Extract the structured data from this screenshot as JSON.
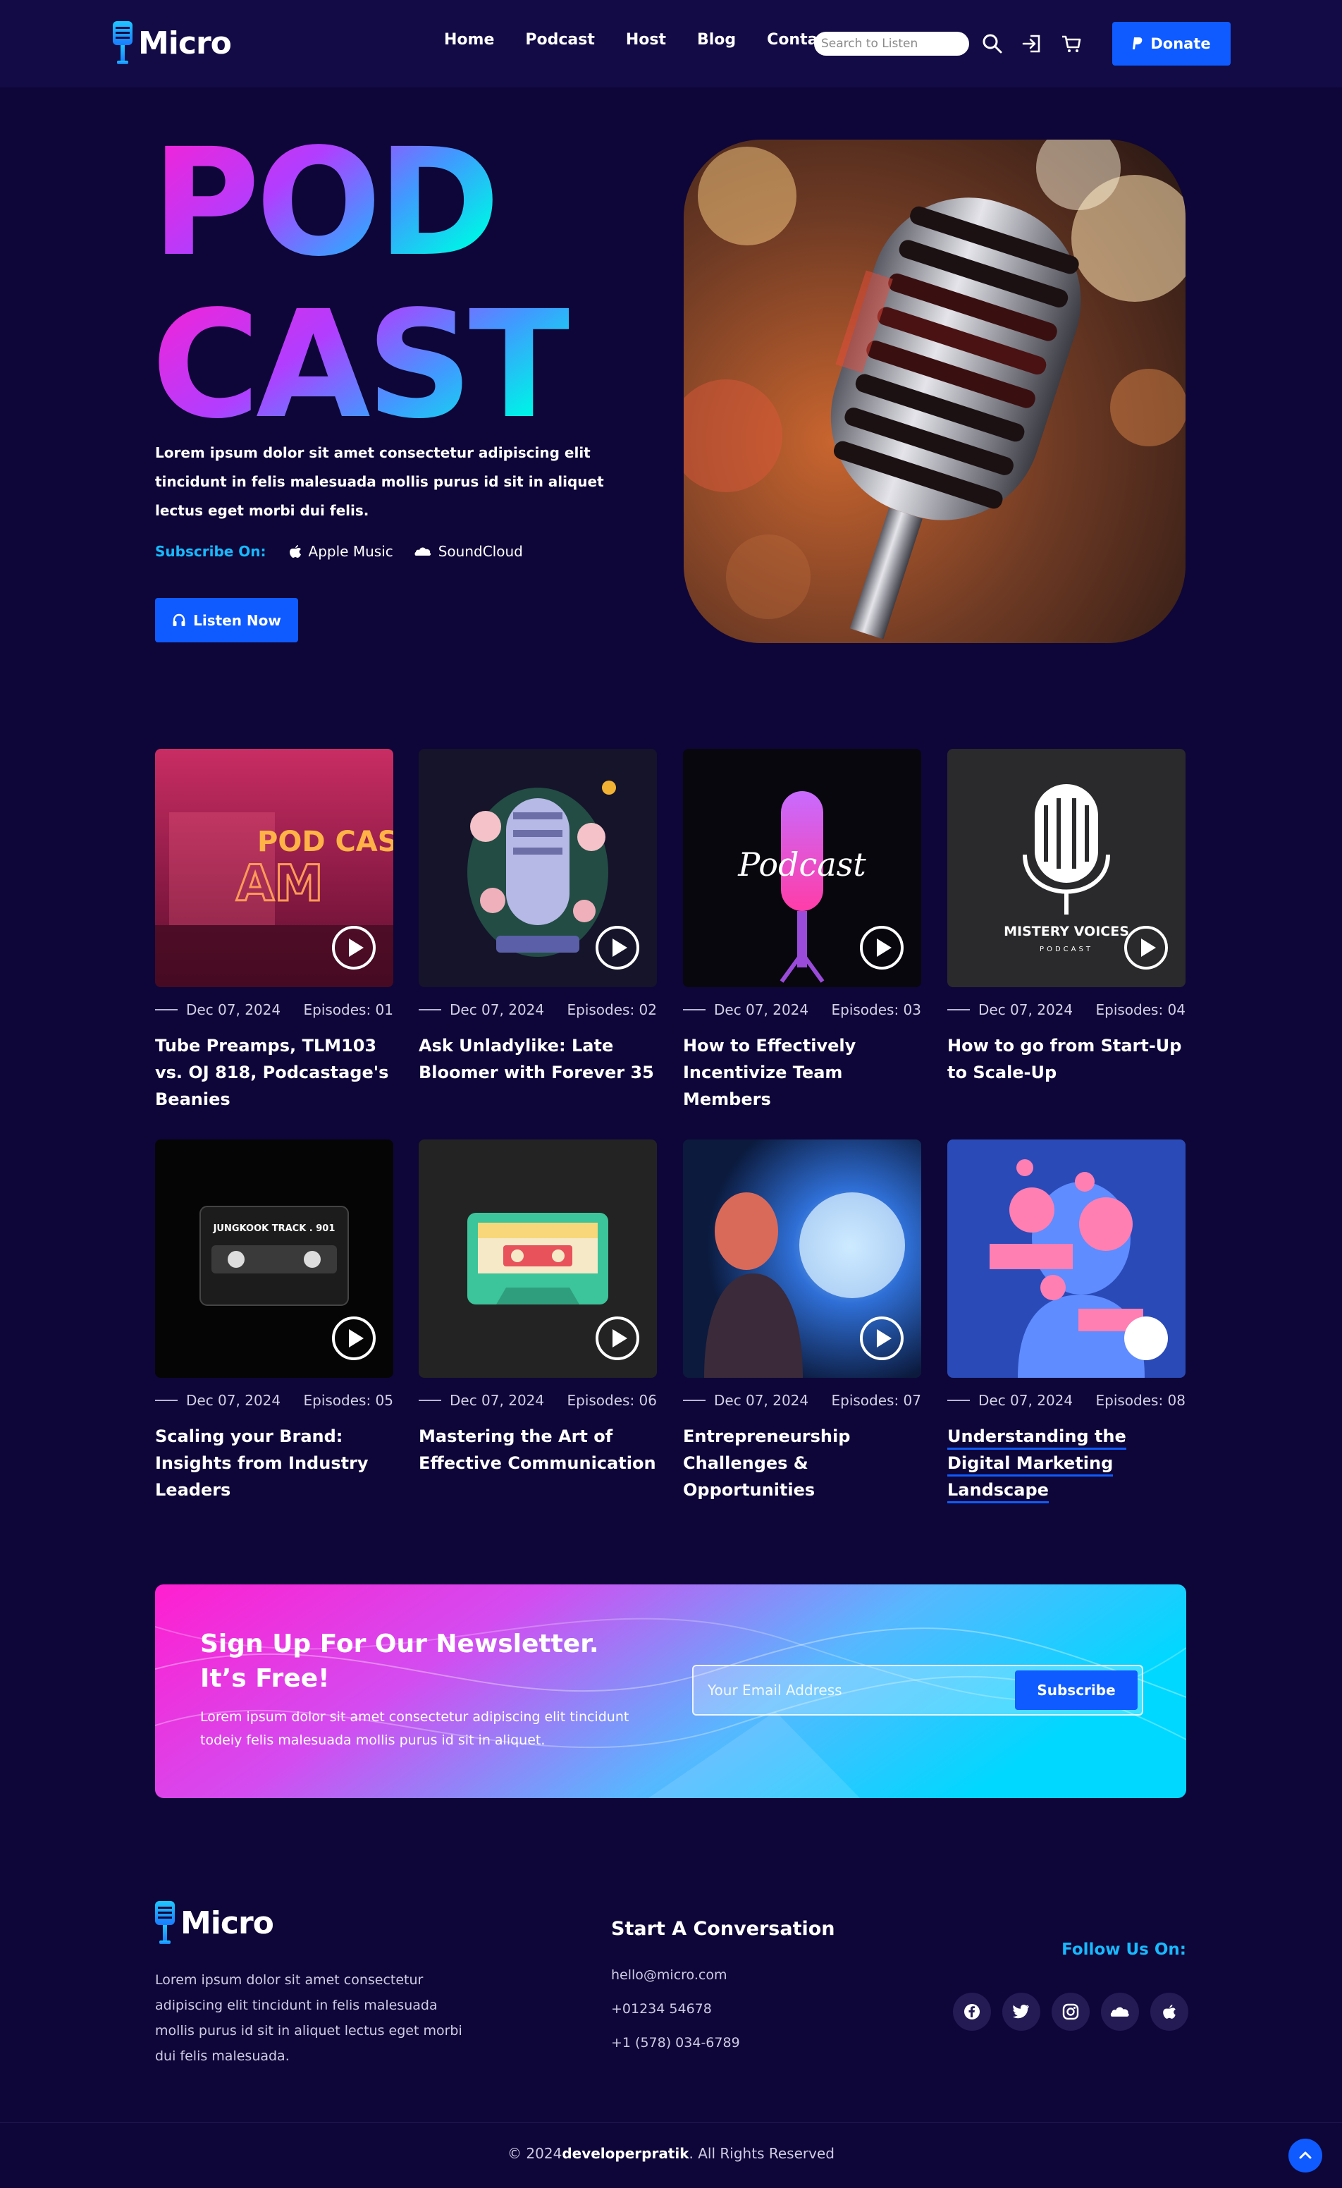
{
  "brand": {
    "name": "Micro"
  },
  "nav": {
    "items": [
      "Home",
      "Podcast",
      "Host",
      "Blog",
      "Contact"
    ],
    "search_placeholder": "Search to Listen",
    "donate_label": "Donate"
  },
  "hero": {
    "title_line1": "POD",
    "title_line2": "CAST",
    "description": "Lorem ipsum dolor sit amet consectetur adipiscing elit tincidunt in felis malesuada mollis purus id sit in aliquet lectus eget morbi dui felis.",
    "subscribe_label": "Subscribe On:",
    "platforms": [
      "Apple Music",
      "SoundCloud"
    ],
    "listen_label": "Listen Now"
  },
  "episodes": [
    {
      "date": "Dec 07, 2024",
      "episode": "Episodes: 01",
      "title": "Tube Preamps, TLM103 vs. OJ 818, Podcastage's Beanies",
      "art_text": "POD CAST",
      "art_sub": "AM"
    },
    {
      "date": "Dec 07, 2024",
      "episode": "Episodes: 02",
      "title": "Ask Unladylike: Late Bloomer with Forever 35"
    },
    {
      "date": "Dec 07, 2024",
      "episode": "Episodes: 03",
      "title": "How to Effectively Incentivize Team Members",
      "art_text": "Podcast"
    },
    {
      "date": "Dec 07, 2024",
      "episode": "Episodes: 04",
      "title": "How to go from Start-Up to Scale-Up",
      "art_text": "MISTERY VOICES",
      "art_sub": "PODCAST"
    },
    {
      "date": "Dec 07, 2024",
      "episode": "Episodes: 05",
      "title": "Scaling your Brand: Insights from Industry Leaders",
      "art_text": "JUNGKOOK TRACK . 901"
    },
    {
      "date": "Dec 07, 2024",
      "episode": "Episodes: 06",
      "title": "Mastering the Art of Effective Communication"
    },
    {
      "date": "Dec 07, 2024",
      "episode": "Episodes: 07",
      "title": "Entrepreneurship Challenges & Opportunities"
    },
    {
      "date": "Dec 07, 2024",
      "episode": "Episodes: 08",
      "title": "Understanding the Digital Marketing Landscape"
    }
  ],
  "newsletter": {
    "title": "Sign Up For Our Newsletter. It’s Free!",
    "description": "Lorem ipsum dolor sit amet consectetur adipiscing elit tincidunt todeiy felis malesuada mollis purus id sit in aliquet.",
    "email_placeholder": "Your Email Address",
    "button_label": "Subscribe"
  },
  "footer": {
    "description": "Lorem ipsum dolor sit amet consectetur adipiscing elit tincidunt in felis malesuada mollis purus id sit in aliquet lectus eget morbi dui felis malesuada.",
    "contact_heading": "Start A Conversation",
    "email": "hello@micro.com",
    "phone1": "+01234 54678",
    "phone2": "+1 (578) 034-6789",
    "follow_label": "Follow Us On:",
    "socials": [
      "facebook-icon",
      "twitter-icon",
      "instagram-icon",
      "soundcloud-icon",
      "apple-icon"
    ],
    "copyright_prefix": "© 2024",
    "copyright_author": "developerpratik",
    "copyright_suffix": ". All Rights Reserved"
  },
  "colors": {
    "background": "#0e0638",
    "header": "#130b45",
    "accent_blue": "#0f5bff",
    "accent_cyan": "#18b9ff",
    "gradient_pink": "#ff1fd0",
    "gradient_cyan": "#00f0e8"
  }
}
